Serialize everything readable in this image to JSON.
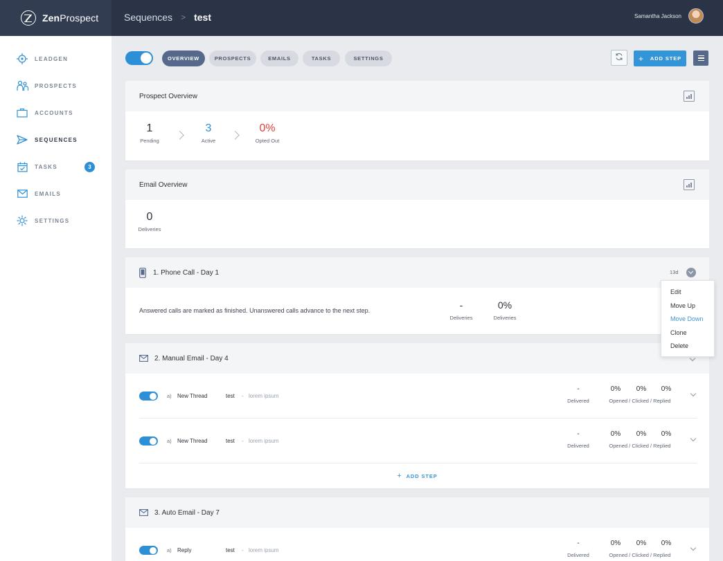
{
  "brand": {
    "name_bold": "Zen",
    "name_rest": "Prospect"
  },
  "breadcrumb": {
    "parent": "Sequences",
    "separator": ">",
    "current": "test"
  },
  "user": {
    "name": "Samantha Jackson"
  },
  "sidebar": {
    "items": [
      {
        "label": "LEADGEN",
        "icon": "target-icon"
      },
      {
        "label": "PROSPECTS",
        "icon": "people-icon"
      },
      {
        "label": "ACCOUNTS",
        "icon": "briefcase-icon"
      },
      {
        "label": "SEQUENCES",
        "icon": "paper-plane-icon",
        "active": true
      },
      {
        "label": "TASKS",
        "icon": "calendar-check-icon",
        "badge": "3"
      },
      {
        "label": "EMAILS",
        "icon": "envelope-icon"
      },
      {
        "label": "SETTINGS",
        "icon": "gear-icon"
      }
    ]
  },
  "toolbar": {
    "sequence_enabled": true,
    "tabs": [
      "OVERVIEW",
      "PROSPECTS",
      "EMAILS",
      "TASKS",
      "SETTINGS"
    ],
    "active_tab": "OVERVIEW",
    "add_step_label": "ADD STEP",
    "add_step_plus": "+"
  },
  "prospect_overview": {
    "title": "Prospect Overview",
    "stats": [
      {
        "value": "1",
        "label": "Pending"
      },
      {
        "value": "3",
        "label": "Active",
        "color": "#2d8fd5"
      },
      {
        "value": "0%",
        "label": "Opted Out",
        "color": "#e0443a"
      }
    ]
  },
  "email_overview": {
    "title": "Email Overview",
    "deliveries_value": "0",
    "deliveries_label": "Deliveries"
  },
  "steps": [
    {
      "title": "1. Phone Call - Day 1",
      "icon": "phone-icon",
      "timer": "13d",
      "description": "Answered calls are marked as finished. Unanswered calls advance to the next step.",
      "stat1_value": "-",
      "stat1_label": "Deliveries",
      "stat2_value": "0%",
      "stat2_label": "Deliveries"
    },
    {
      "title": "2. Manual Email - Day 4",
      "icon": "envelope-icon",
      "rows": [
        {
          "enabled": true,
          "letter": "a)",
          "thread": "New Thread",
          "subject": "test",
          "sep": "-",
          "preview": "lorem ipsum",
          "delivered": "-",
          "delivered_label": "Delivered",
          "opened": "0%",
          "clicked": "0%",
          "replied": "0%",
          "rates_label": "Opened / Clicked / Replied"
        },
        {
          "enabled": true,
          "letter": "a)",
          "thread": "New Thread",
          "subject": "test",
          "sep": "-",
          "preview": "lorem ipsum",
          "delivered": "-",
          "delivered_label": "Delivered",
          "opened": "0%",
          "clicked": "0%",
          "replied": "0%",
          "rates_label": "Opened / Clicked / Replied"
        }
      ],
      "add_step_label": "ADD STEP",
      "add_step_plus": "+"
    },
    {
      "title": "3. Auto Email - Day 7",
      "icon": "envelope-icon",
      "rows": [
        {
          "enabled": true,
          "letter": "a)",
          "thread": "Reply",
          "subject": "test",
          "sep": "-",
          "preview": "lorem ipsum",
          "delivered": "-",
          "delivered_label": "Delivered",
          "opened": "0%",
          "clicked": "0%",
          "replied": "0%",
          "rates_label": "Opened / Clicked / Replied"
        }
      ]
    }
  ],
  "dropdown": {
    "items": [
      "Edit",
      "Move Up",
      "Move Down",
      "Clone",
      "Delete"
    ],
    "highlighted": "Move Down"
  },
  "colors": {
    "accent": "#2d8fd5",
    "danger": "#e0443a",
    "topbar": "#2a3446",
    "tab_active": "#56698a"
  }
}
